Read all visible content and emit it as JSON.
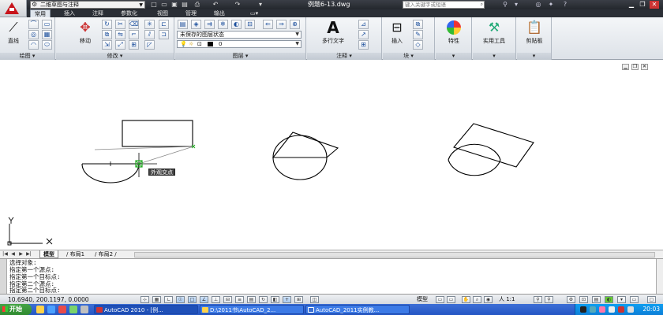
{
  "titlebar": {
    "workspace": "二维草图与注释",
    "document": "例题6-13.dwg",
    "search_placeholder": "键入关键字或短语",
    "qat_icons": [
      "new-file-icon",
      "open-file-icon",
      "save-icon",
      "saveas-icon",
      "plot-icon",
      "undo-icon",
      "redo-icon",
      "workspace-toggle-icon"
    ]
  },
  "tabs": [
    "常用",
    "插入",
    "注释",
    "参数化",
    "视图",
    "管理",
    "输出"
  ],
  "ribbon": {
    "panels": {
      "draw": "绘图",
      "modify": "修改",
      "layers": "图层",
      "annotation": "注释",
      "block": "块",
      "properties": "",
      "utilities": "",
      "clipboard": ""
    },
    "buttons": {
      "line": "直线",
      "move": "移动",
      "multiline_text": "多行文字",
      "insert": "插入",
      "properties": "特性",
      "utilities": "实用工具",
      "clipboard": "剪贴板"
    },
    "layer_state": "未保存的图层状态",
    "layer_current": "0"
  },
  "canvas": {
    "osnap_tooltip": "外观交点",
    "colors": {
      "geometry": "#000000",
      "tracking": "#22aa22",
      "snap_marker": "#22aa22"
    }
  },
  "layout_tabs": [
    "模型",
    "布局1",
    "布局2"
  ],
  "command_history": [
    "选择对象:",
    "指定第一个源点:",
    "指定第一个目标点:",
    "指定第二个源点:",
    "指定第二个目标点:"
  ],
  "status": {
    "coordinates": "10.6940,  200.1197,  0.0000",
    "model_label": "模型",
    "annotation_scale": "人 1:1"
  },
  "taskbar": {
    "start": "开始",
    "tasks": [
      "AutoCAD 2010 - [例...",
      "D:\\2011书\\AutoCAD_2...",
      "AutoCAD_2011实例教..."
    ],
    "clock": "20:03"
  }
}
